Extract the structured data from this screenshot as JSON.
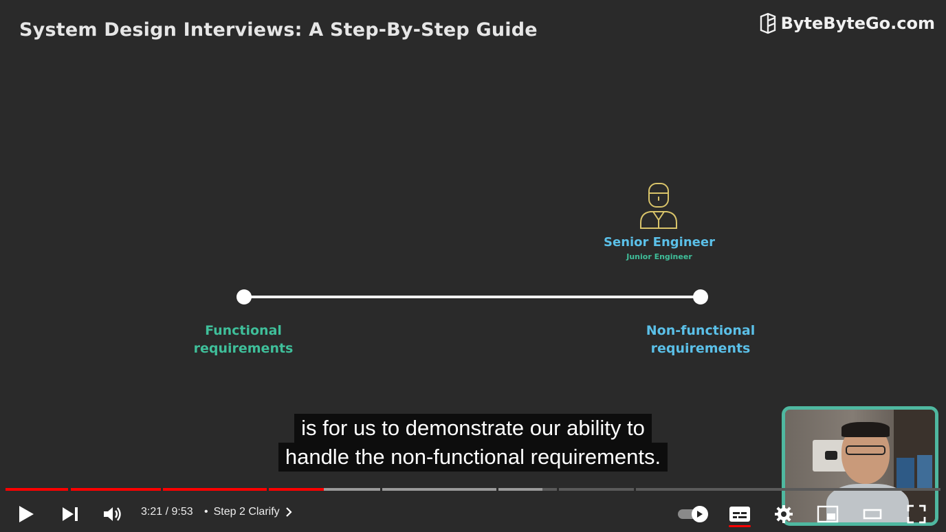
{
  "slide": {
    "title": "System Design Interviews: A Step-By-Step Guide",
    "brand": "ByteByteGo.com",
    "engineer_primary": "Senior Engineer",
    "engineer_secondary": "Junior Engineer",
    "left_req": [
      "Functional",
      "requirements"
    ],
    "right_req": [
      "Non-functional",
      "requirements"
    ]
  },
  "captions": [
    "is for us to demonstrate our ability to",
    "handle the non-functional requirements."
  ],
  "player": {
    "current_time": "3:21",
    "separator": "/",
    "duration": "9:53",
    "chapter_bullet": "•",
    "chapter_title": "Step 2 Clarify",
    "progress_played_fraction": 0.339,
    "autoplay_on": true,
    "captions_on": true,
    "colors": {
      "played": "#ff0000",
      "buffered": "#9a9a9a",
      "unbuffered": "#5a5a5a",
      "webcam_border": "#4fb8a0",
      "senior_label": "#5bc0e8",
      "functional_label": "#3fbf9a"
    },
    "icons": [
      "play-icon",
      "next-icon",
      "volume-icon",
      "chevron-right-icon",
      "autoplay-toggle-icon",
      "subtitles-icon",
      "gear-icon",
      "miniplayer-icon",
      "theater-icon",
      "fullscreen-icon"
    ]
  }
}
